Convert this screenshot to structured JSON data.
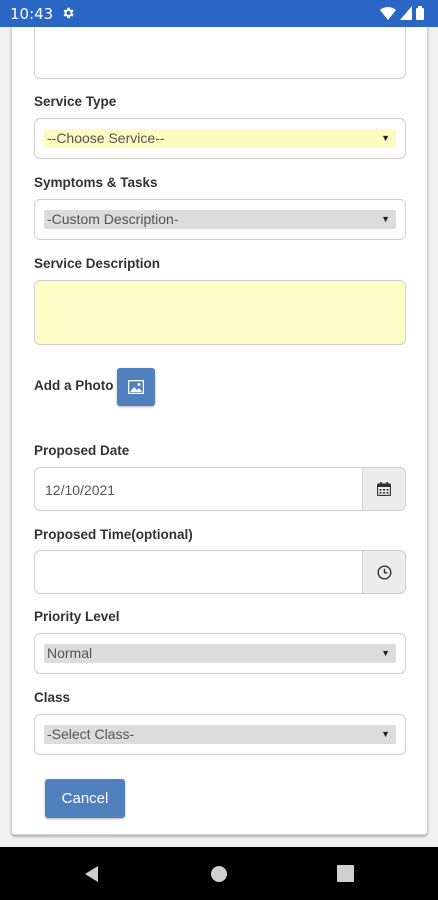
{
  "status_bar": {
    "time": "10:43"
  },
  "form": {
    "service_type": {
      "label": "Service Type",
      "selected": "--Choose Service--"
    },
    "symptoms_tasks": {
      "label": "Symptoms & Tasks",
      "selected": "-Custom Description-"
    },
    "service_description": {
      "label": "Service Description",
      "value": ""
    },
    "add_photo": {
      "label": "Add a Photo"
    },
    "proposed_date": {
      "label": "Proposed Date",
      "value": "12/10/2021"
    },
    "proposed_time": {
      "label": "Proposed Time(optional)",
      "value": ""
    },
    "priority_level": {
      "label": "Priority Level",
      "selected": "Normal"
    },
    "class": {
      "label": "Class",
      "selected": "-Select Class-"
    },
    "cancel_label": "Cancel"
  },
  "colors": {
    "status_bar": "#2a66c4",
    "primary_button": "#4f7fbd",
    "highlight_field": "#fdfcc0"
  }
}
